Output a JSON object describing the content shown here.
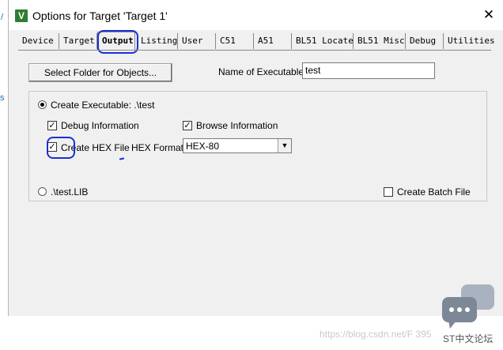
{
  "window": {
    "title": "Options for Target 'Target 1'",
    "close_label": "✕"
  },
  "tabs": [
    {
      "label": "Device",
      "active": false
    },
    {
      "label": "Target",
      "active": false
    },
    {
      "label": "Output",
      "active": true
    },
    {
      "label": "Listing",
      "active": false
    },
    {
      "label": "User",
      "active": false
    },
    {
      "label": "C51",
      "active": false
    },
    {
      "label": "A51",
      "active": false
    },
    {
      "label": "BL51 Locate",
      "active": false
    },
    {
      "label": "BL51 Misc",
      "active": false
    },
    {
      "label": "Debug",
      "active": false
    },
    {
      "label": "Utilities",
      "active": false
    }
  ],
  "output": {
    "select_folder_label": "Select Folder for Objects...",
    "name_label": "Name of Executable:",
    "name_value": "test",
    "create_executable_label": "Create Executable:  .\\test",
    "create_executable_selected": true,
    "debug_info_label": "Debug Information",
    "debug_info_checked": true,
    "browse_info_label": "Browse Information",
    "browse_info_checked": true,
    "create_hex_label": "Create HEX File",
    "create_hex_checked": true,
    "hex_format_label": "HEX Format:",
    "hex_format_value": "HEX-80",
    "lib_label": ".\\test.LIB",
    "lib_selected": false,
    "batch_label": "Create Batch File",
    "batch_checked": false
  },
  "watermark": {
    "url": "https://blog.csdn.net/F       395",
    "brand": "ST中文论坛"
  },
  "colors": {
    "annotation": "#1a2fd6",
    "dialog_bg": "#f0f0f0"
  }
}
